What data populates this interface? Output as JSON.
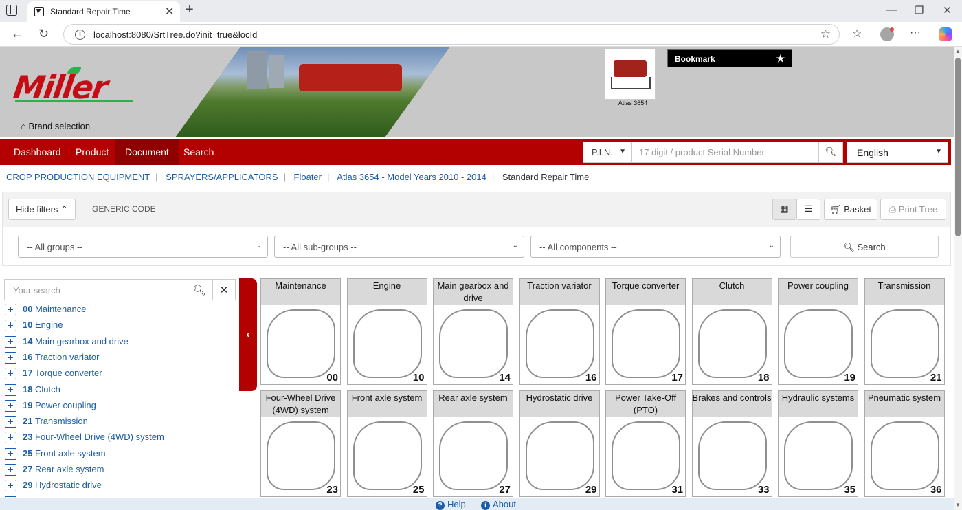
{
  "browser": {
    "tab_title": "Standard Repair Time",
    "url": "localhost:8080/SrtTree.do?init=true&locId="
  },
  "header": {
    "logo_text": "Miller",
    "brand_selection": "Brand selection",
    "machine_caption": "Atlas 3654",
    "bookmark_label": "Bookmark"
  },
  "nav": {
    "items": [
      "Dashboard",
      "Product",
      "Document",
      "Search"
    ],
    "active": "Document",
    "pin_label": "P.I.N.",
    "pin_placeholder": "17 digit / product Serial Number",
    "language": "English"
  },
  "breadcrumb": {
    "links": [
      "CROP PRODUCTION EQUIPMENT",
      "SPRAYERS/APPLICATORS",
      "Floater",
      "Atlas 3654 - Model Years 2010 - 2014"
    ],
    "current": "Standard Repair Time"
  },
  "filters": {
    "hide_filters": "Hide filters",
    "generic_code": "GENERIC CODE",
    "basket": "Basket",
    "print_tree": "Print Tree",
    "groups": "-- All groups --",
    "subgroups": "-- All sub-groups --",
    "components": "-- All components --",
    "search": "Search"
  },
  "tree": {
    "search_placeholder": "Your search",
    "items": [
      {
        "code": "00",
        "label": "Maintenance"
      },
      {
        "code": "10",
        "label": "Engine"
      },
      {
        "code": "14",
        "label": "Main gearbox and drive"
      },
      {
        "code": "16",
        "label": "Traction variator"
      },
      {
        "code": "17",
        "label": "Torque converter"
      },
      {
        "code": "18",
        "label": "Clutch"
      },
      {
        "code": "19",
        "label": "Power coupling"
      },
      {
        "code": "21",
        "label": "Transmission"
      },
      {
        "code": "23",
        "label": "Four-Wheel Drive (4WD) system"
      },
      {
        "code": "25",
        "label": "Front axle system"
      },
      {
        "code": "27",
        "label": "Rear axle system"
      },
      {
        "code": "29",
        "label": "Hydrostatic drive"
      }
    ]
  },
  "cards": [
    {
      "title": "Maintenance",
      "num": "00"
    },
    {
      "title": "Engine",
      "num": "10"
    },
    {
      "title": "Main gearbox and drive",
      "num": "14"
    },
    {
      "title": "Traction variator",
      "num": "16"
    },
    {
      "title": "Torque converter",
      "num": "17"
    },
    {
      "title": "Clutch",
      "num": "18"
    },
    {
      "title": "Power coupling",
      "num": "19"
    },
    {
      "title": "Transmission",
      "num": "21"
    },
    {
      "title": "Four-Wheel Drive (4WD) system",
      "num": "23"
    },
    {
      "title": "Front axle system",
      "num": "25"
    },
    {
      "title": "Rear axle system",
      "num": "27"
    },
    {
      "title": "Hydrostatic drive",
      "num": "29"
    },
    {
      "title": "Power Take-Off (PTO)",
      "num": "31"
    },
    {
      "title": "Brakes and controls",
      "num": "33"
    },
    {
      "title": "Hydraulic systems",
      "num": "35"
    },
    {
      "title": "Pneumatic system",
      "num": "36"
    }
  ],
  "footer": {
    "help": "Help",
    "about": "About"
  }
}
